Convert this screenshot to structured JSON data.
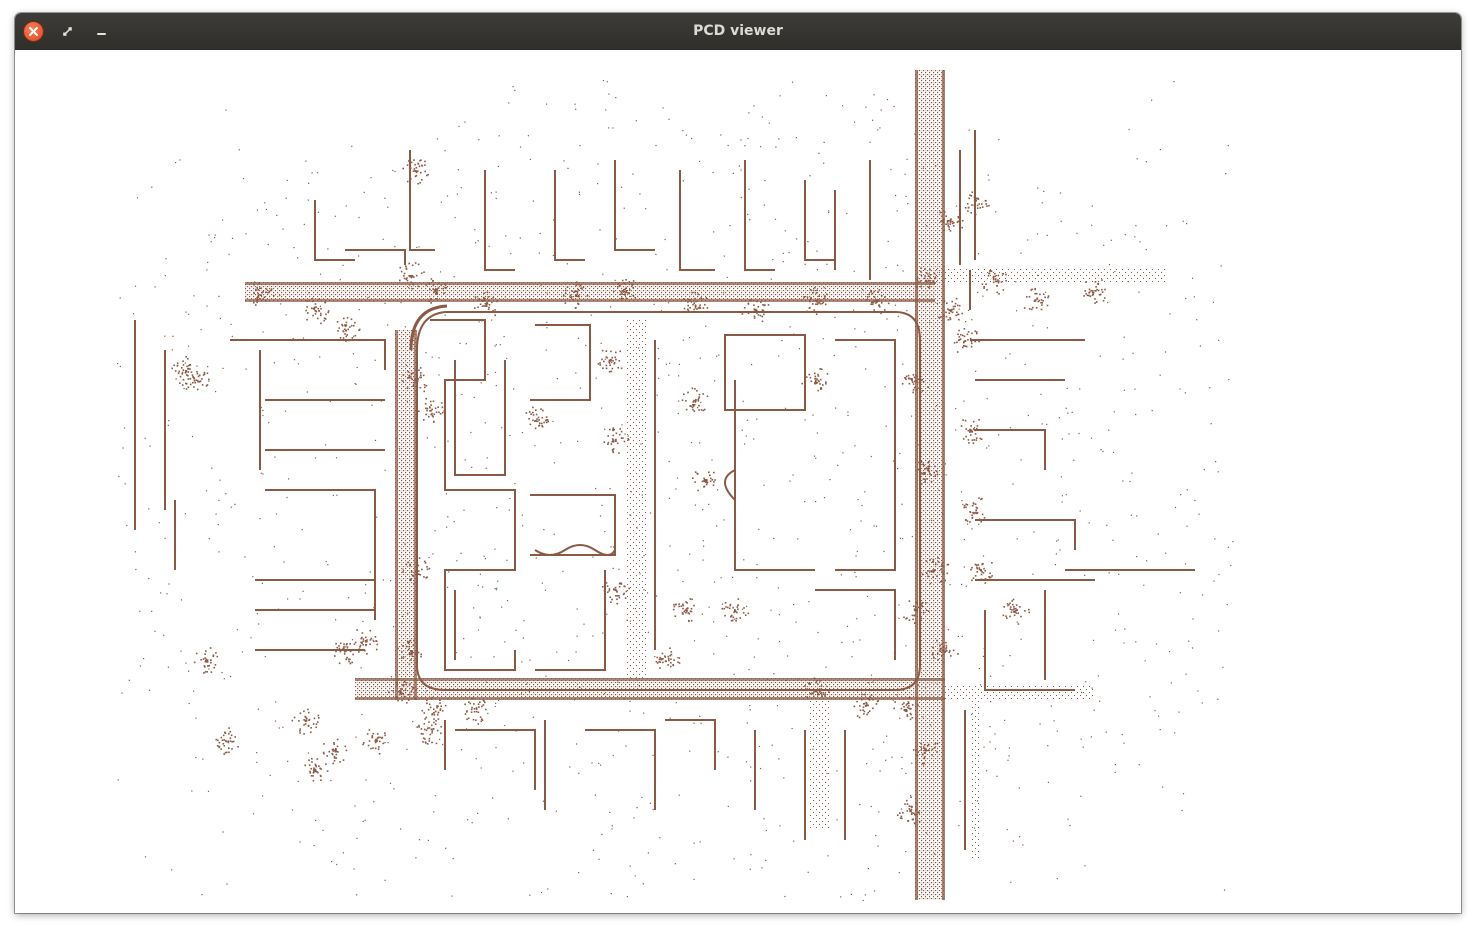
{
  "window": {
    "title": "PCD viewer"
  },
  "controls": {
    "close_icon": "close-icon",
    "maximize_icon": "maximize-icon",
    "minimize_icon": "minimize-icon"
  },
  "colors": {
    "titlebar": "#302f2c",
    "title_text": "#dfdbd2",
    "close_button": "#e2461f",
    "point_cloud": "#8b5a44",
    "background": "#ffffff"
  }
}
